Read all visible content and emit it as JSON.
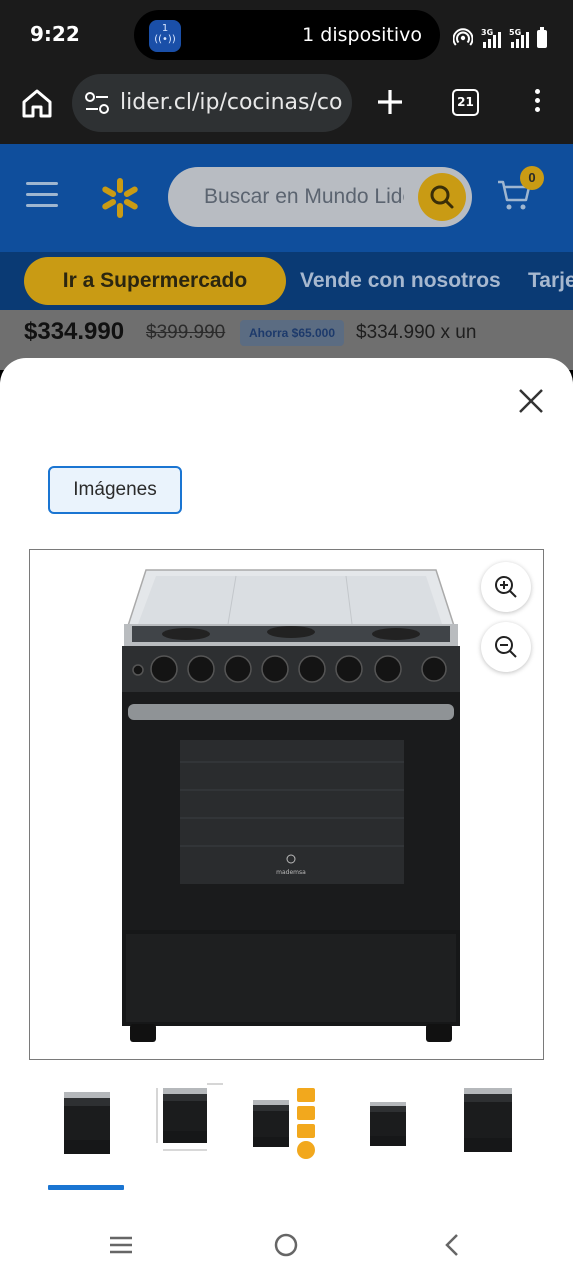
{
  "status_bar": {
    "time": "9:22",
    "pill_text": "1 dispositivo",
    "pill_badge": "1",
    "net1": "3G",
    "net2": "5G"
  },
  "browser": {
    "url": "lider.cl/ip/cocinas/co",
    "tab_count": "21"
  },
  "site": {
    "search_placeholder": "Buscar en Mundo Lider",
    "cart_count": "0",
    "nav": {
      "supermercado": "Ir a Supermercado",
      "vende": "Vende con nosotros",
      "tarjeta": "Tarje"
    },
    "price": {
      "current": "$334.990",
      "old": "$399.990",
      "savings": "Ahorra $65.000",
      "per_unit": "$334.990 x un"
    }
  },
  "modal": {
    "chip_label": "Imágenes",
    "brand_logo": "mademsa",
    "thumbnails": [
      "stove-front",
      "stove-dimensions",
      "stove-features",
      "stove-small",
      "stove-angle"
    ],
    "selected_thumbnail": 0
  },
  "colors": {
    "accent": "#1a75d2",
    "brand_blue": "#0f4e9c",
    "brand_yellow": "#c99b14"
  }
}
